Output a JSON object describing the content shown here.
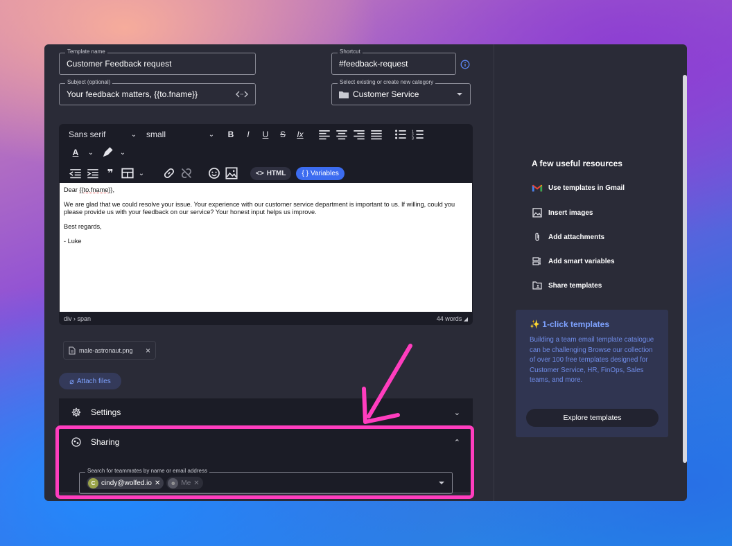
{
  "form": {
    "template_name_label": "Template name",
    "template_name": "Customer Feedback request",
    "shortcut_label": "Shortcut",
    "shortcut": "#feedback-request",
    "subject_label": "Subject (optional)",
    "subject": "Your feedback matters, {{to.fname}}",
    "category_label": "Select existing or create new category",
    "category": "Customer Service"
  },
  "toolbar": {
    "font_family": "Sans serif",
    "font_size": "small",
    "html_label": "HTML",
    "variables_label": "Variables"
  },
  "body": {
    "greeting_prefix": "Dear ",
    "greeting_var": "{{to.fname}}",
    "greeting_suffix": ",",
    "paragraph": "We are glad that we could resolve your issue. Your experience with our customer service department is important to us. If willing, could you please provide us with your feedback on our service? Your honest input helps us improve.",
    "closing": "Best regards,",
    "signature": "- Luke"
  },
  "status": {
    "path": "div › span",
    "word_count": "44 words"
  },
  "attachment": {
    "filename": "male-astronaut.png",
    "attach_label": "Attach files"
  },
  "settings": {
    "label": "Settings"
  },
  "sharing": {
    "label": "Sharing",
    "search_label": "Search for teammates by name or email address",
    "chips": [
      {
        "initial": "C",
        "label": "cindy@wolfed.io"
      },
      {
        "label": "Me"
      }
    ]
  },
  "resources": {
    "title": "A few useful resources",
    "items": [
      {
        "label": "Use templates in Gmail",
        "icon": "gmail-icon"
      },
      {
        "label": "Insert images",
        "icon": "image-icon"
      },
      {
        "label": "Add attachments",
        "icon": "paperclip-icon"
      },
      {
        "label": "Add smart variables",
        "icon": "variables-icon"
      },
      {
        "label": "Share templates",
        "icon": "share-folder-icon"
      }
    ]
  },
  "promo": {
    "title": "1-click templates",
    "text": "Building a team email template catalogue can be challenging  Browse our collection of over 100 free templates designed for Customer Service, HR, FinOps, Sales teams, and more.",
    "button": "Explore templates"
  },
  "colors": {
    "accent": "#3c6cf0",
    "highlight": "#ff3dbe",
    "panel": "#2a2b37",
    "editor": "#1b1c26"
  }
}
